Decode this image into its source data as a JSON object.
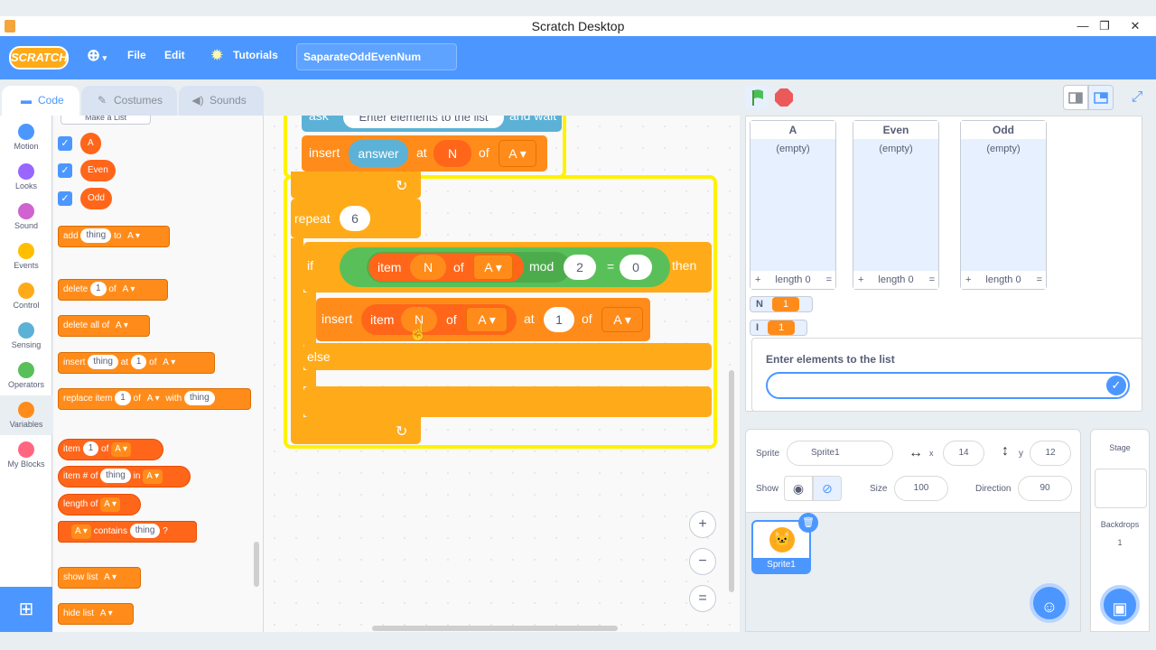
{
  "window": {
    "title": "Scratch Desktop",
    "minimize": "—",
    "restore": "❐",
    "close": "✕"
  },
  "menubar": {
    "logo": "SCRATCH",
    "globe_icon": "⊕",
    "file": "File",
    "edit": "Edit",
    "tutorials_icon": "✹",
    "tutorials": "Tutorials",
    "project_title": "SaparateOddEvenNum"
  },
  "tabs": [
    {
      "label": "Code",
      "icon": "▬"
    },
    {
      "label": "Costumes",
      "icon": "✎"
    },
    {
      "label": "Sounds",
      "icon": "◀)"
    }
  ],
  "categories": [
    {
      "label": "Motion",
      "color": "#4c97ff"
    },
    {
      "label": "Looks",
      "color": "#9966ff"
    },
    {
      "label": "Sound",
      "color": "#cf63cf"
    },
    {
      "label": "Events",
      "color": "#ffbf00"
    },
    {
      "label": "Control",
      "color": "#ffab19"
    },
    {
      "label": "Sensing",
      "color": "#5cb1d6"
    },
    {
      "label": "Operators",
      "color": "#59c059"
    },
    {
      "label": "Variables",
      "color": "#ff8c1a"
    },
    {
      "label": "My Blocks",
      "color": "#ff6680"
    }
  ],
  "extension_icon": "⊞",
  "palette": {
    "make_list": "Make a List",
    "check": "✓",
    "lists": [
      "A",
      "Even",
      "Odd"
    ],
    "add": {
      "w1": "add",
      "in1": "thing",
      "w2": "to",
      "dd": "A ▾"
    },
    "delete": {
      "w1": "delete",
      "in1": "1",
      "w2": "of",
      "dd": "A ▾"
    },
    "delete_all": {
      "w1": "delete all of",
      "dd": "A ▾"
    },
    "insert": {
      "w1": "insert",
      "in1": "thing",
      "w2": "at",
      "in2": "1",
      "w3": "of",
      "dd": "A ▾"
    },
    "replace": {
      "w1": "replace item",
      "in1": "1",
      "w2": "of",
      "dd": "A ▾",
      "w3": "with",
      "in2": "thing"
    },
    "item": {
      "w1": "item",
      "in1": "1",
      "w2": "of",
      "dd": "A ▾"
    },
    "item_num": {
      "w1": "item # of",
      "in1": "thing",
      "w2": "in",
      "dd": "A ▾"
    },
    "length": {
      "w1": "length of",
      "dd": "A ▾"
    },
    "contains": {
      "dd": "A ▾",
      "w1": "contains",
      "in1": "thing",
      "w2": "?"
    },
    "show_list": {
      "w1": "show list",
      "dd": "A ▾"
    },
    "hide_list": {
      "w1": "hide list",
      "dd": "A ▾"
    }
  },
  "script": {
    "ask_text": "ask",
    "ask_input": "Enter elements to the list",
    "ask_wait": "and wait",
    "insert1": {
      "w1": "insert",
      "reporter": "answer",
      "w2": "at",
      "var": "N",
      "w3": "of",
      "dd": "A ▾"
    },
    "arrow": "↻",
    "repeat": {
      "w1": "repeat",
      "in1": "6"
    },
    "if": {
      "w1": "if",
      "item": "item",
      "var": "N",
      "of": "of",
      "dd": "A ▾",
      "mod": "mod",
      "in1": "2",
      "eq": "=",
      "in2": "0",
      "then": "then"
    },
    "insert2": {
      "w1": "insert",
      "item": "item",
      "var": "N",
      "of": "of",
      "dd": "A ▾",
      "at": "at",
      "in1": "1",
      "of2": "of",
      "dd2": "A ▾"
    },
    "else": "else"
  },
  "zoom": {
    "in": "+",
    "out": "−",
    "reset": "="
  },
  "stage_controls": {
    "flag_icon": "flag",
    "stop_icon": "stop",
    "fullscreen": "⤢"
  },
  "monitors": [
    {
      "name": "A",
      "empty": "(empty)",
      "plus": "+",
      "length": "length 0",
      "eq": "="
    },
    {
      "name": "Even",
      "empty": "(empty)",
      "plus": "+",
      "length": "length 0",
      "eq": "="
    },
    {
      "name": "Odd",
      "empty": "(empty)",
      "plus": "+",
      "length": "length 0",
      "eq": "="
    }
  ],
  "var_monitors": [
    {
      "name": "N",
      "value": "1"
    },
    {
      "name": "I",
      "value": "1"
    }
  ],
  "ask_prompt": {
    "question": "Enter elements to the list",
    "ok": "✓"
  },
  "sprite_info": {
    "sprite_label": "Sprite",
    "sprite_name": "Sprite1",
    "x_icon": "↔",
    "x_label": "x",
    "x": "14",
    "y_icon": "↕",
    "y_label": "y",
    "y": "12",
    "show_label": "Show",
    "show_icon": "◉",
    "hide_icon": "⊘",
    "size_label": "Size",
    "size": "100",
    "direction_label": "Direction",
    "direction": "90"
  },
  "sprites": [
    {
      "name": "Sprite1",
      "delete": "🗑"
    }
  ],
  "stage_panel": {
    "label": "Stage",
    "backdrops": "Backdrops",
    "count": "1"
  },
  "fab_sprite": "☺",
  "fab_backdrop": "▣"
}
